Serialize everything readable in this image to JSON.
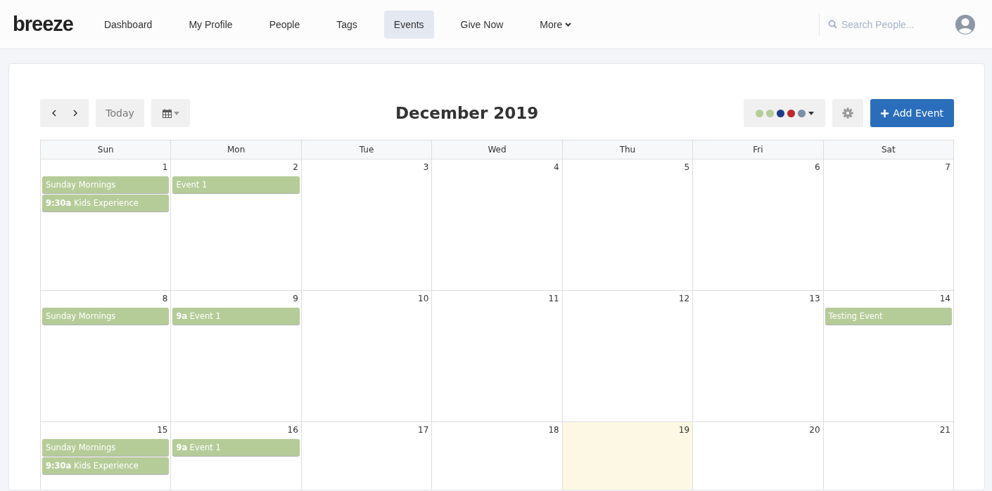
{
  "logo": "breeze",
  "nav": [
    {
      "label": "Dashboard",
      "selected": false
    },
    {
      "label": "My Profile",
      "selected": false
    },
    {
      "label": "People",
      "selected": false
    },
    {
      "label": "Tags",
      "selected": false
    },
    {
      "label": "Events",
      "selected": true
    },
    {
      "label": "Give Now",
      "selected": false
    },
    {
      "label": "More",
      "selected": false,
      "kind": "dropdown"
    }
  ],
  "search": {
    "placeholder": "Search People..."
  },
  "toolbar": {
    "today": "Today",
    "title": "December 2019",
    "add_button": "Add Event",
    "filter_colors": [
      {
        "color": "#b5cc98"
      },
      {
        "color": "#b5cc98"
      },
      {
        "color": "#1e3a8e"
      },
      {
        "color": "#c0282b"
      },
      {
        "color": "#7a8fa3"
      }
    ]
  },
  "weekdays": [
    "Sun",
    "Mon",
    "Tue",
    "Wed",
    "Thu",
    "Fri",
    "Sat"
  ],
  "weeks": [
    [
      {
        "day": "1",
        "today": false,
        "events": [
          "Sunday Mornings",
          "**9:30a** Kids Experience"
        ]
      },
      {
        "day": "2",
        "today": false,
        "events": [
          "Event 1"
        ]
      },
      {
        "day": "3",
        "today": false
      },
      {
        "day": "4",
        "today": false
      },
      {
        "day": "5",
        "today": false
      },
      {
        "day": "6",
        "today": false
      },
      {
        "day": "7",
        "today": false
      }
    ],
    [
      {
        "day": "8",
        "today": false,
        "events": [
          "Sunday Mornings"
        ]
      },
      {
        "day": "9",
        "today": false,
        "events": [
          "**9a** Event 1"
        ]
      },
      {
        "day": "10",
        "today": false
      },
      {
        "day": "11",
        "today": false
      },
      {
        "day": "12",
        "today": false
      },
      {
        "day": "13",
        "today": false
      },
      {
        "day": "14",
        "today": false,
        "events": [
          "Testing Event"
        ]
      }
    ],
    [
      {
        "day": "15",
        "today": false,
        "events": [
          "Sunday Mornings",
          "**9:30a** Kids Experience"
        ]
      },
      {
        "day": "16",
        "today": false,
        "events": [
          "**9a** Event 1"
        ]
      },
      {
        "day": "17",
        "today": false
      },
      {
        "day": "18",
        "today": false
      },
      {
        "day": "19",
        "today": true
      },
      {
        "day": "20",
        "today": false
      },
      {
        "day": "21",
        "today": false
      }
    ]
  ]
}
